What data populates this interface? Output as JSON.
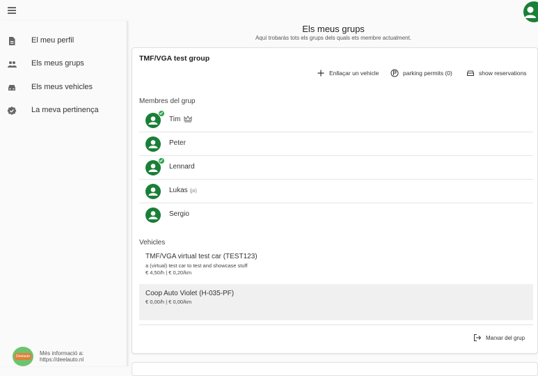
{
  "sidebar": {
    "items": [
      {
        "label": "El meu perfil",
        "icon": "document-icon"
      },
      {
        "label": "Els meus grups",
        "icon": "people-icon"
      },
      {
        "label": "Els meus vehicles",
        "icon": "car-icon"
      },
      {
        "label": "La meva pertinença",
        "icon": "verified-badge-icon"
      }
    ],
    "footer": {
      "line1": "Més informació a:",
      "line2": "https://deelauto.nl",
      "logo_text": "Deelauto"
    }
  },
  "page": {
    "title": "Els meus grups",
    "subtitle": "Aquí trobaràs tots els grups dels quals ets membre actualment."
  },
  "group": {
    "name": "TMF/VGA test group",
    "actions": {
      "link_vehicle": "Enllaçar un vehicle",
      "parking_permits": "parking permits (0)",
      "show_reservations": "show reservations"
    },
    "members_label": "Membres del grup",
    "members": [
      {
        "name": "Tim",
        "me": "",
        "verified": true,
        "admin": true
      },
      {
        "name": "Peter",
        "me": "",
        "verified": false,
        "admin": false
      },
      {
        "name": "Lennard",
        "me": "",
        "verified": true,
        "admin": false
      },
      {
        "name": "Lukas",
        "me": "(jo)",
        "verified": false,
        "admin": false
      },
      {
        "name": "Sergio",
        "me": "",
        "verified": false,
        "admin": false
      }
    ],
    "vehicles_label": "Vehicles",
    "vehicles": [
      {
        "name": "TMF/VGA virtual test car (TEST123)",
        "description": "a (virtual) test car to test and showcase stuff",
        "price": "€ 4,50/h | € 0,20/km"
      },
      {
        "name": "Coop Auto Violet (H-035-PF)",
        "description": "",
        "price": "€ 0,00/h | € 0,00/km"
      }
    ],
    "leave_label": "Marxar del grup"
  },
  "colors": {
    "accent": "#1a7f37",
    "verified": "#2ea44f"
  }
}
